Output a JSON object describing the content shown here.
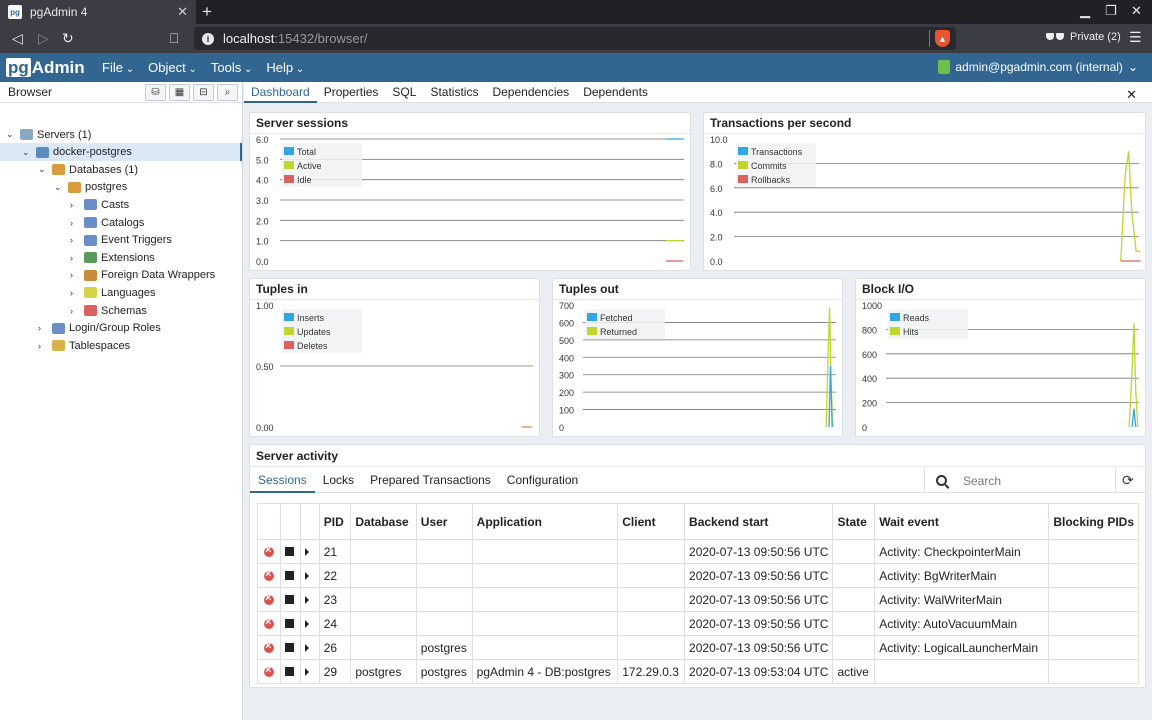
{
  "browser_chrome": {
    "tab_title": "pgAdmin 4",
    "tab_favicon": "pg",
    "url_host": "localhost",
    "url_path": ":15432/browser/",
    "private_label": "Private (2)"
  },
  "navbar": {
    "logo_pg": "pg",
    "logo_admin": "Admin",
    "menus": [
      "File",
      "Object",
      "Tools",
      "Help"
    ],
    "user": "admin@pgadmin.com (internal)"
  },
  "browser_panel": {
    "title": "Browser",
    "tree": [
      {
        "label": "Servers (1)",
        "icon": "servers-icon"
      },
      {
        "label": "docker-postgres",
        "icon": "elephant-icon"
      },
      {
        "label": "Databases (1)",
        "icon": "databases-icon"
      },
      {
        "label": "postgres",
        "icon": "database-icon"
      },
      {
        "label": "Casts",
        "icon": "casts-icon"
      },
      {
        "label": "Catalogs",
        "icon": "catalogs-icon"
      },
      {
        "label": "Event Triggers",
        "icon": "event-triggers-icon"
      },
      {
        "label": "Extensions",
        "icon": "extensions-icon"
      },
      {
        "label": "Foreign Data Wrappers",
        "icon": "fdw-icon"
      },
      {
        "label": "Languages",
        "icon": "languages-icon"
      },
      {
        "label": "Schemas",
        "icon": "schemas-icon"
      },
      {
        "label": "Login/Group Roles",
        "icon": "roles-icon"
      },
      {
        "label": "Tablespaces",
        "icon": "tablespaces-icon"
      }
    ]
  },
  "main_tabs": [
    "Dashboard",
    "Properties",
    "SQL",
    "Statistics",
    "Dependencies",
    "Dependents"
  ],
  "colors": {
    "blue": "#2fa8e2",
    "green": "#bed62e",
    "red": "#d9625f",
    "brand": "#326690"
  },
  "charts": {
    "server_sessions": {
      "title": "Server sessions",
      "yticks": [
        "6.0",
        "5.0",
        "4.0",
        "3.0",
        "2.0",
        "1.0",
        "0.0"
      ],
      "legend": [
        "Total",
        "Active",
        "Idle"
      ]
    },
    "tps": {
      "title": "Transactions per second",
      "yticks": [
        "10.0",
        "8.0",
        "6.0",
        "4.0",
        "2.0",
        "0.0"
      ],
      "legend": [
        "Transactions",
        "Commits",
        "Rollbacks"
      ]
    },
    "tuples_in": {
      "title": "Tuples in",
      "yticks": [
        "1.00",
        "0.50",
        "0.00"
      ],
      "legend": [
        "Inserts",
        "Updates",
        "Deletes"
      ]
    },
    "tuples_out": {
      "title": "Tuples out",
      "yticks": [
        "700",
        "600",
        "500",
        "400",
        "300",
        "200",
        "100",
        "0"
      ],
      "legend": [
        "Fetched",
        "Returned"
      ]
    },
    "block_io": {
      "title": "Block I/O",
      "yticks": [
        "1000",
        "800",
        "600",
        "400",
        "200",
        "0"
      ],
      "legend": [
        "Reads",
        "Hits"
      ]
    }
  },
  "activity": {
    "title": "Server activity",
    "tabs": [
      "Sessions",
      "Locks",
      "Prepared Transactions",
      "Configuration"
    ],
    "search_placeholder": "Search",
    "columns": [
      "PID",
      "Database",
      "User",
      "Application",
      "Client",
      "Backend start",
      "State",
      "Wait event",
      "Blocking PIDs"
    ],
    "rows": [
      {
        "pid": "21",
        "database": "",
        "user": "",
        "application": "",
        "client": "",
        "backend_start": "2020-07-13 09:50:56 UTC",
        "state": "",
        "wait_event": "Activity: CheckpointerMain",
        "blocking": ""
      },
      {
        "pid": "22",
        "database": "",
        "user": "",
        "application": "",
        "client": "",
        "backend_start": "2020-07-13 09:50:56 UTC",
        "state": "",
        "wait_event": "Activity: BgWriterMain",
        "blocking": ""
      },
      {
        "pid": "23",
        "database": "",
        "user": "",
        "application": "",
        "client": "",
        "backend_start": "2020-07-13 09:50:56 UTC",
        "state": "",
        "wait_event": "Activity: WalWriterMain",
        "blocking": ""
      },
      {
        "pid": "24",
        "database": "",
        "user": "",
        "application": "",
        "client": "",
        "backend_start": "2020-07-13 09:50:56 UTC",
        "state": "",
        "wait_event": "Activity: AutoVacuumMain",
        "blocking": ""
      },
      {
        "pid": "26",
        "database": "",
        "user": "postgres",
        "application": "",
        "client": "",
        "backend_start": "2020-07-13 09:50:56 UTC",
        "state": "",
        "wait_event": "Activity: LogicalLauncherMain",
        "blocking": ""
      },
      {
        "pid": "29",
        "database": "postgres",
        "user": "postgres",
        "application": "pgAdmin 4 - DB:postgres",
        "client": "172.29.0.3",
        "backend_start": "2020-07-13 09:53:04 UTC",
        "state": "active",
        "wait_event": "",
        "blocking": ""
      }
    ]
  }
}
